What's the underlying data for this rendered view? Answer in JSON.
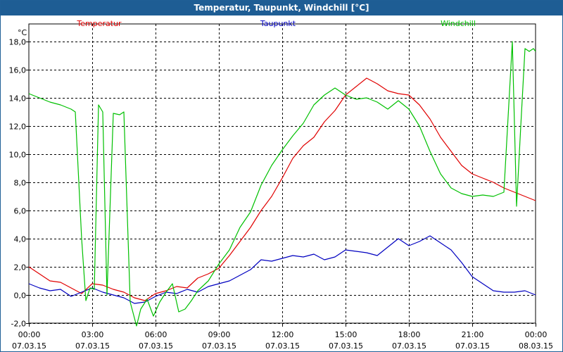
{
  "window": {
    "title": "Temperatur, Taupunkt, Windchill [°C]"
  },
  "chart_data": {
    "type": "line",
    "title": "Temperatur, Taupunkt, Windchill [°C]",
    "ylabel": "°C",
    "ylim": [
      -2.0,
      18.0
    ],
    "yticks": [
      "18,0",
      "16,0",
      "14,0",
      "12,0",
      "10,0",
      "8,0",
      "6,0",
      "4,0",
      "2,0",
      "0,0",
      "-2,0"
    ],
    "ytick_values": [
      18,
      16,
      14,
      12,
      10,
      8,
      6,
      4,
      2,
      0,
      -2
    ],
    "xlim": [
      0,
      24
    ],
    "xticks": [
      {
        "h": 0,
        "time": "00:00",
        "date": "07.03.15"
      },
      {
        "h": 3,
        "time": "03:00",
        "date": "07.03.15"
      },
      {
        "h": 6,
        "time": "06:00",
        "date": "07.03.15"
      },
      {
        "h": 9,
        "time": "09:00",
        "date": "07.03.15"
      },
      {
        "h": 12,
        "time": "12:00",
        "date": "07.03.15"
      },
      {
        "h": 15,
        "time": "15:00",
        "date": "07.03.15"
      },
      {
        "h": 18,
        "time": "18:00",
        "date": "07.03.15"
      },
      {
        "h": 21,
        "time": "21:00",
        "date": "07.03.15"
      },
      {
        "h": 24,
        "time": "00:00",
        "date": "08.03.15"
      }
    ],
    "grid": true,
    "legend_position": "top",
    "series": [
      {
        "name": "Temperatur",
        "color": "#e00000",
        "x": [
          0,
          0.5,
          1,
          1.5,
          2,
          2.5,
          3,
          3.5,
          4,
          4.5,
          5,
          5.5,
          6,
          6.5,
          7,
          7.5,
          8,
          8.5,
          9,
          9.5,
          10,
          10.5,
          11,
          11.5,
          12,
          12.5,
          13,
          13.5,
          14,
          14.5,
          15,
          15.5,
          16,
          16.5,
          17,
          17.5,
          18,
          18.5,
          19,
          19.5,
          20,
          20.5,
          21,
          21.5,
          22,
          22.5,
          23,
          23.5,
          24
        ],
        "y": [
          2.0,
          1.5,
          1.0,
          0.9,
          0.5,
          0.1,
          0.8,
          0.7,
          0.4,
          0.2,
          -0.2,
          -0.4,
          0.1,
          0.3,
          0.6,
          0.5,
          1.2,
          1.5,
          1.9,
          2.8,
          3.8,
          4.8,
          6.0,
          7.0,
          8.3,
          9.7,
          10.6,
          11.2,
          12.3,
          13.1,
          14.2,
          14.8,
          15.4,
          15.0,
          14.5,
          14.3,
          14.2,
          13.5,
          12.5,
          11.2,
          10.2,
          9.2,
          8.6,
          8.3,
          8.0,
          7.6,
          7.3,
          7.0,
          6.7
        ]
      },
      {
        "name": "Taupunkt",
        "color": "#0000c0",
        "x": [
          0,
          0.5,
          1,
          1.5,
          2,
          2.5,
          3,
          3.5,
          4,
          4.5,
          5,
          5.5,
          6,
          6.5,
          7,
          7.5,
          8,
          8.5,
          9,
          9.5,
          10,
          10.5,
          11,
          11.5,
          12,
          12.5,
          13,
          13.5,
          14,
          14.5,
          15,
          15.5,
          16,
          16.5,
          17,
          17.5,
          18,
          18.5,
          19,
          19.5,
          20,
          20.5,
          21,
          21.5,
          22,
          22.5,
          23,
          23.5,
          24
        ],
        "y": [
          0.8,
          0.5,
          0.3,
          0.4,
          -0.1,
          0.2,
          0.5,
          0.2,
          0.0,
          -0.2,
          -0.6,
          -0.5,
          -0.1,
          0.2,
          0.1,
          0.4,
          0.2,
          0.6,
          0.8,
          1.0,
          1.4,
          1.8,
          2.5,
          2.4,
          2.6,
          2.8,
          2.7,
          2.9,
          2.5,
          2.7,
          3.2,
          3.1,
          3.0,
          2.8,
          3.4,
          4.0,
          3.5,
          3.8,
          4.2,
          3.7,
          3.2,
          2.3,
          1.3,
          0.8,
          0.3,
          0.2,
          0.2,
          0.3,
          0.0
        ]
      },
      {
        "name": "Windchill",
        "color": "#00c000",
        "x": [
          0,
          0.5,
          1,
          1.5,
          2,
          2.2,
          2.5,
          2.7,
          2.9,
          3.1,
          3.3,
          3.5,
          3.7,
          4.0,
          4.3,
          4.5,
          4.8,
          5.1,
          5.3,
          5.6,
          5.9,
          6.2,
          6.5,
          6.8,
          7.1,
          7.4,
          7.7,
          8.0,
          8.5,
          9,
          9.5,
          10,
          10.5,
          11,
          11.5,
          12,
          12.5,
          13,
          13.5,
          14,
          14.5,
          15,
          15.5,
          16,
          16.5,
          17,
          17.5,
          18,
          18.5,
          19,
          19.5,
          20,
          20.5,
          21,
          21.5,
          22,
          22.5,
          22.9,
          23.1,
          23.3,
          23.5,
          23.7,
          23.9,
          24
        ],
        "y": [
          14.3,
          14.0,
          13.7,
          13.5,
          13.2,
          13.0,
          4.0,
          -0.4,
          0.5,
          0.4,
          13.5,
          13.0,
          0.0,
          12.9,
          12.8,
          13.0,
          -0.5,
          -2.2,
          -1.0,
          -0.3,
          -1.5,
          -0.5,
          0.2,
          0.8,
          -1.2,
          -1.0,
          -0.4,
          0.3,
          1.0,
          2.2,
          3.2,
          4.8,
          5.9,
          7.8,
          9.2,
          10.3,
          11.3,
          12.2,
          13.5,
          14.2,
          14.7,
          14.2,
          13.9,
          14.0,
          13.7,
          13.2,
          13.8,
          13.2,
          12.0,
          10.2,
          8.6,
          7.6,
          7.2,
          7.0,
          7.1,
          7.0,
          7.3,
          18.0,
          6.3,
          12.0,
          17.5,
          17.3,
          17.5,
          17.3
        ]
      }
    ]
  }
}
